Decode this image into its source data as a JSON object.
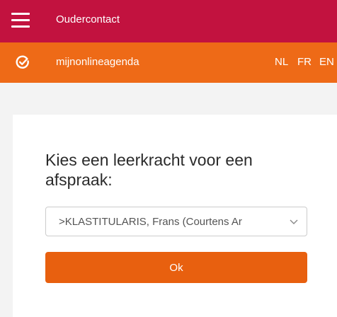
{
  "topbar": {
    "title": "Oudercontact",
    "menu_icon": "hamburger-menu-icon"
  },
  "brandbar": {
    "logo_icon": "check-circle-icon",
    "name": "mijnonlineagenda",
    "languages": [
      "NL",
      "FR",
      "EN"
    ]
  },
  "form": {
    "heading": "Kies een leerkracht voor een afspraak:",
    "teacher_select": {
      "selected": ">KLASTITULARIS, Frans (Courtens Ar"
    },
    "ok_label": "Ok"
  },
  "colors": {
    "topbar": "#c2123f",
    "brandbar": "#ee6a17",
    "button": "#e8600f",
    "background": "#f3f3f3"
  }
}
